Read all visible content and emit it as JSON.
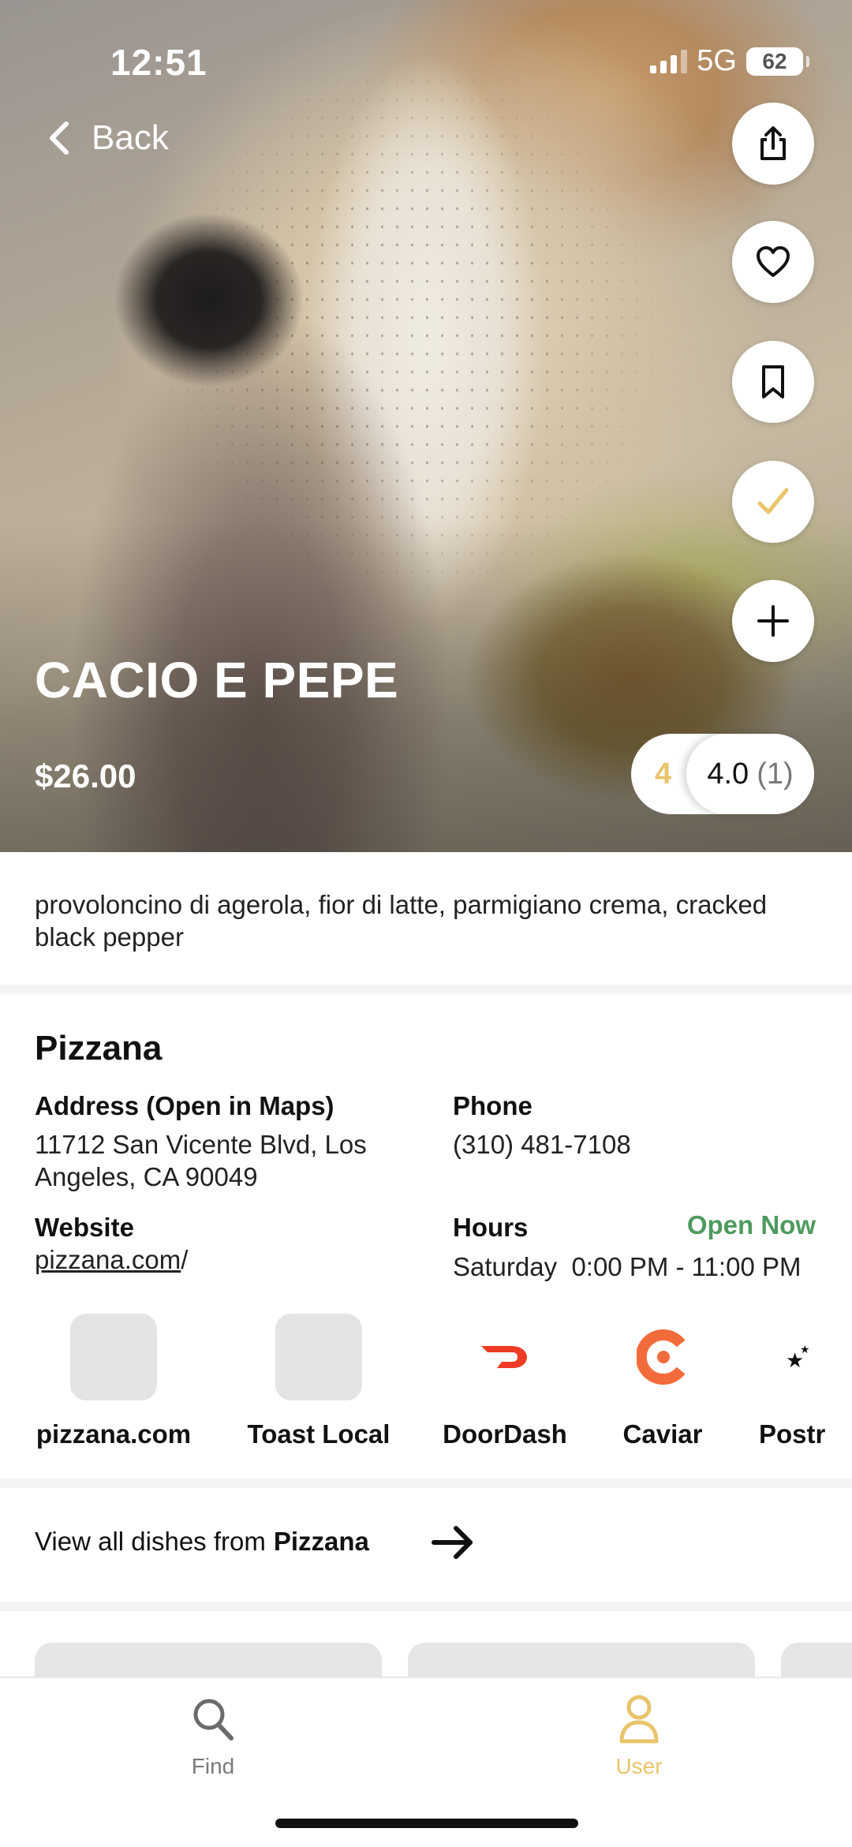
{
  "status_bar": {
    "time": "12:51",
    "network": "5G",
    "battery": "62"
  },
  "nav": {
    "back_label": "Back"
  },
  "dish": {
    "name": "CACIO E PEPE",
    "price": "$26.00",
    "description": "provoloncino di agerola, fior di latte, parmigiano crema, cracked black pepper",
    "rating": {
      "user_rating": "4",
      "average": "4.0",
      "count": "(1)"
    }
  },
  "actions": [
    "share-icon",
    "heart-icon",
    "bookmark-icon",
    "check-icon",
    "plus-icon"
  ],
  "restaurant": {
    "name": "Pizzana",
    "address_label": "Address (Open in Maps)",
    "address_line1": "11712 San Vicente Blvd, Los",
    "address_line2": "Angeles, CA 90049",
    "phone_label": "Phone",
    "phone": "(310) 481-7108",
    "website_label": "Website",
    "website_link": "pizzana.com",
    "website_suffix": "/",
    "hours_label": "Hours",
    "open_status": "Open Now",
    "hours_day": "Saturday",
    "hours_time": "0:00 PM - 11:00 PM"
  },
  "services": [
    {
      "name": "pizzana.com"
    },
    {
      "name": "Toast Local"
    },
    {
      "name": "DoorDash"
    },
    {
      "name": "Caviar"
    },
    {
      "name": "Postr"
    }
  ],
  "view_all": {
    "prefix": "View all dishes from",
    "restaurant": "Pizzana"
  },
  "tabbar": {
    "find": "Find",
    "user": "User"
  },
  "colors": {
    "accent": "#e9c46a",
    "open": "#4f9a5e",
    "doordash": "#ef3a24",
    "caviar": "#f26b3a"
  }
}
